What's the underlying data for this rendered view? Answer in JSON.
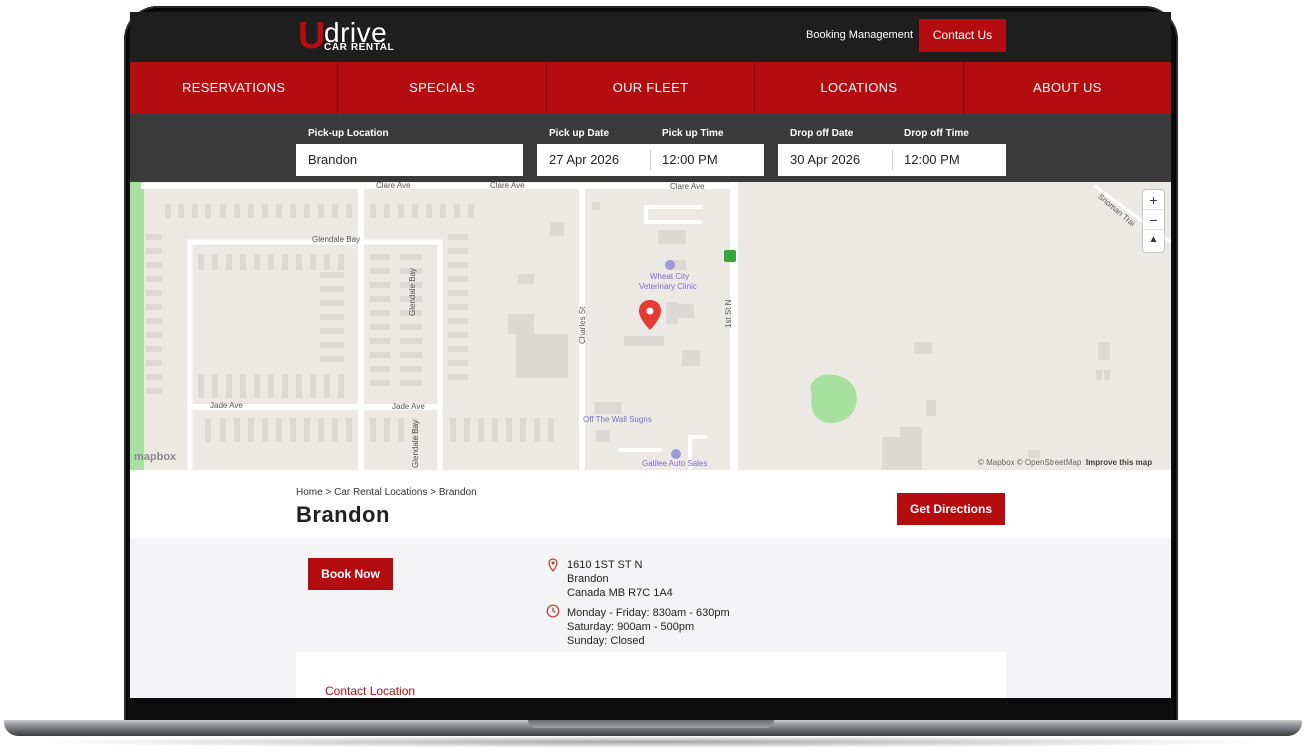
{
  "brand": {
    "logo_letter": "U",
    "logo_word": "drive",
    "logo_sub": "CAR RENTAL",
    "accent": "#b40d10",
    "header_bg": "#1e1e1f"
  },
  "header": {
    "booking_link": "Booking Management",
    "contact_button": "Contact Us"
  },
  "nav": {
    "items": [
      {
        "label": "RESERVATIONS"
      },
      {
        "label": "SPECIALS"
      },
      {
        "label": "OUR FLEET"
      },
      {
        "label": "LOCATIONS"
      },
      {
        "label": "ABOUT US"
      }
    ]
  },
  "search": {
    "pickup_location_label": "Pick-up Location",
    "pickup_location_value": "Brandon",
    "pickup_date_label": "Pick up Date",
    "pickup_date_value": "27 Apr 2026",
    "pickup_time_label": "Pick up Time",
    "pickup_time_value": "12:00 PM",
    "dropoff_date_label": "Drop off Date",
    "dropoff_date_value": "30 Apr 2026",
    "dropoff_time_label": "Drop off Time",
    "dropoff_time_value": "12:00 PM"
  },
  "map": {
    "streets": {
      "clare_ave_1": "Clare Ave",
      "clare_ave_2": "Clare Ave",
      "clare_ave_3": "Clare Ave",
      "glendale_bay_h": "Glendale Bay",
      "glendale_bay_v1": "Glendale Bay",
      "glendale_bay_v2": "Glendale Bay",
      "jade_ave_1": "Jade Ave",
      "jade_ave_2": "Jade Ave",
      "charles_st": "Charles St",
      "first_st_n": "1st St N",
      "snoman_trail": "Snoman Trai"
    },
    "pois": {
      "vet_line1": "Wheat City",
      "vet_line2": "Veterinary Clinic",
      "off_the_wall": "Off The Wall Sugns",
      "galilee": "Galilee Auto Sales"
    },
    "zoom_in": "+",
    "zoom_out": "−",
    "compass": "▲",
    "logo": "mapbox",
    "attribution": "© Mapbox © OpenStreetMap",
    "improve": "Improve this map",
    "road_color": "#ffffff",
    "park_color": "#a8e0a0",
    "marker_color": "#e53935"
  },
  "location": {
    "breadcrumb": "Home > Car Rental Locations > Brandon",
    "title": "Brandon",
    "directions_button": "Get Directions",
    "book_button": "Book Now",
    "address": [
      "1610 1ST ST N",
      "Brandon",
      "Canada MB R7C 1A4"
    ],
    "hours": [
      "Monday - Friday: 830am - 630pm",
      "Saturday: 900am - 500pm",
      "Sunday: Closed"
    ],
    "contact_link": "Contact Location"
  }
}
